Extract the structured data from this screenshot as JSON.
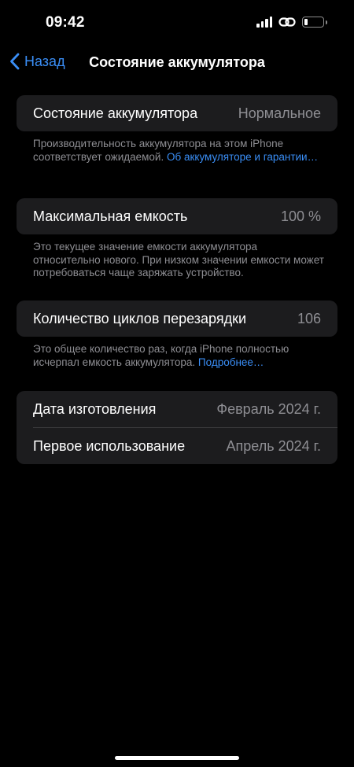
{
  "status_bar": {
    "time": "09:42"
  },
  "nav": {
    "back_label": "Назад",
    "title": "Состояние аккумулятора"
  },
  "sections": {
    "battery_health": {
      "label": "Состояние аккумулятора",
      "value": "Нормальное",
      "footnote": "Производительность аккумулятора на этом iPhone соответствует ожидаемой. ",
      "footnote_link": "Об аккумуляторе и гарантии…"
    },
    "max_capacity": {
      "label": "Максимальная емкость",
      "value": "100 %",
      "footnote": "Это текущее значение емкости аккумулятора относительно нового. При низком значении емкости может потребоваться чаще заряжать устройство."
    },
    "cycle_count": {
      "label": "Количество циклов перезарядки",
      "value": "106",
      "footnote": "Это общее количество раз, когда iPhone полностью исчерпал емкость аккумулятора. ",
      "footnote_link": "Подробнее…"
    },
    "dates": {
      "manufacture_label": "Дата изготовления",
      "manufacture_value": "Февраль 2024 г.",
      "first_use_label": "Первое использование",
      "first_use_value": "Апрель 2024 г."
    }
  },
  "colors": {
    "accent": "#3a8ef6",
    "card_bg": "#1c1c1e",
    "secondary_text": "#8e8e93"
  }
}
